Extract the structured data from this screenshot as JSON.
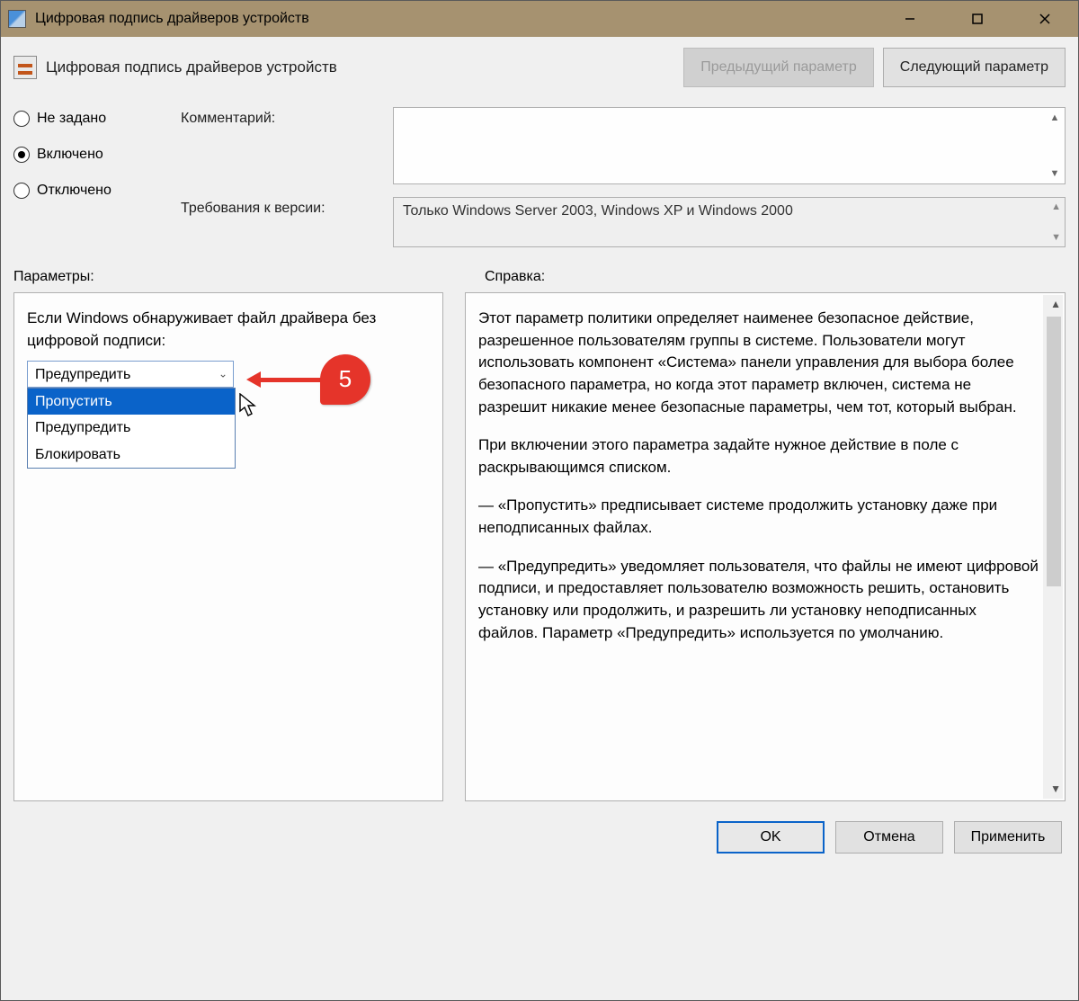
{
  "titlebar": {
    "title": "Цифровая подпись драйверов устройств"
  },
  "header": {
    "policy_title": "Цифровая подпись драйверов устройств",
    "prev_btn": "Предыдущий параметр",
    "next_btn": "Следующий параметр"
  },
  "radios": {
    "not_configured": "Не задано",
    "enabled": "Включено",
    "disabled": "Отключено",
    "selected": "enabled"
  },
  "fields": {
    "comment_label": "Комментарий:",
    "comment_value": "",
    "requirements_label": "Требования к версии:",
    "requirements_value": "Только Windows Server 2003, Windows XP и Windows 2000"
  },
  "sections": {
    "options_label": "Параметры:",
    "help_label": "Справка:"
  },
  "options_panel": {
    "prompt": "Если Windows обнаруживает файл драйвера без цифровой подписи:",
    "selected": "Предупредить",
    "items": [
      "Пропустить",
      "Предупредить",
      "Блокировать"
    ],
    "highlighted_index": 0
  },
  "annotation": {
    "number": "5"
  },
  "help_panel": {
    "p1": "Этот параметр политики определяет наименее безопасное действие, разрешенное пользователям группы в системе. Пользователи могут использовать компонент «Система» панели управления для выбора более безопасного параметра, но когда этот параметр включен, система не разрешит никакие менее безопасные параметры, чем тот, который выбран.",
    "p2": "При включении этого параметра задайте нужное действие в поле с раскрывающимся списком.",
    "p3": "— «Пропустить» предписывает системе продолжить установку даже при неподписанных файлах.",
    "p4": "— «Предупредить» уведомляет пользователя, что файлы не имеют цифровой подписи, и предоставляет пользователю возможность решить, остановить установку или продолжить, и разрешить ли установку неподписанных файлов. Параметр «Предупредить» используется по умолчанию."
  },
  "footer": {
    "ok": "OK",
    "cancel": "Отмена",
    "apply": "Применить"
  }
}
